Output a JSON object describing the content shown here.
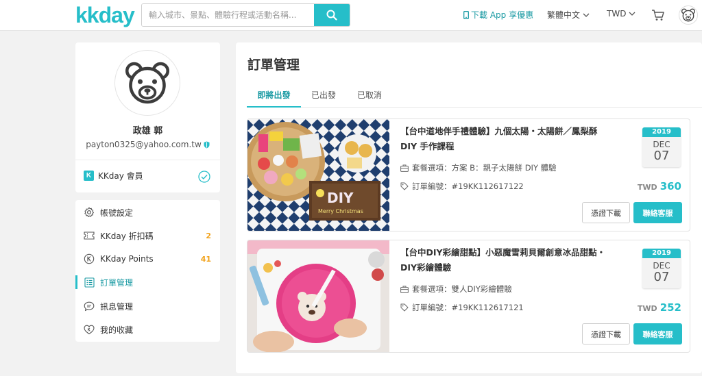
{
  "brand": {
    "logo": "kkday",
    "color": "#26bec9"
  },
  "search": {
    "placeholder": "輸入城市、景點、體驗行程或活動名稱..."
  },
  "nav": {
    "app_download": "下載 App 享優惠",
    "language": "繁體中文",
    "currency": "TWD"
  },
  "profile": {
    "name": "政雄 郭",
    "email": "payton0325@yahoo.com.tw",
    "member_label": "KKday 會員"
  },
  "menu": [
    {
      "label": "帳號設定",
      "icon": "gear-icon",
      "count": ""
    },
    {
      "label": "KKday 折扣碼",
      "icon": "coupon-icon",
      "count": "2"
    },
    {
      "label": "KKday Points",
      "icon": "points-icon",
      "count": "41"
    },
    {
      "label": "訂單管理",
      "icon": "order-list-icon",
      "count": ""
    },
    {
      "label": "訊息管理",
      "icon": "message-icon",
      "count": ""
    },
    {
      "label": "我的收藏",
      "icon": "heart-icon",
      "count": ""
    }
  ],
  "main": {
    "title": "訂單管理",
    "tabs": [
      {
        "label": "即將出發"
      },
      {
        "label": "已出發"
      },
      {
        "label": "已取消"
      }
    ],
    "orders": [
      {
        "title": "【台中道地伴手禮體驗】九個太陽・太陽餅／鳳梨酥 DIY 手作課程",
        "package": "套餐選項：方案 B：親子太陽餅 DIY 體驗",
        "order_no": "訂單編號：#19KK112617122",
        "year": "2019",
        "month": "DEC",
        "day": "07",
        "currency": "TWD",
        "amount": "360",
        "image_text": "DIY",
        "image_subtext": "Merry Christmas",
        "voucher_label": "憑證下載",
        "contact_label": "聯絡客服"
      },
      {
        "title": "【台中DIY彩繪甜點】小惡魔雪莉貝爾創意冰品甜點・DIY彩繪體驗",
        "package": "套餐選項：雙人DIY彩繪體驗",
        "order_no": "訂單編號：#19KK112617121",
        "year": "2019",
        "month": "DEC",
        "day": "07",
        "currency": "TWD",
        "amount": "252",
        "voucher_label": "憑證下載",
        "contact_label": "聯絡客服"
      }
    ]
  }
}
